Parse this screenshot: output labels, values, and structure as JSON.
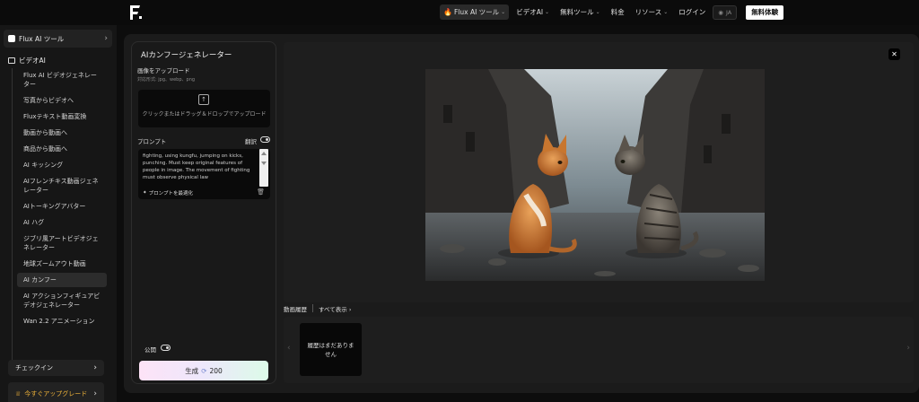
{
  "nav": {
    "items": [
      {
        "label": "Flux AI ツール",
        "active": true,
        "dropdown": true
      },
      {
        "label": "ビデオAI",
        "dropdown": true
      },
      {
        "label": "無料ツール",
        "dropdown": true
      },
      {
        "label": "料金",
        "dropdown": false
      },
      {
        "label": "リソース",
        "dropdown": true
      },
      {
        "label": "ログイン",
        "dropdown": false
      }
    ],
    "language": "JA",
    "trial_button": "無料体験"
  },
  "sidebar": {
    "tool_header": "Flux AI ツール",
    "video_section": "ビデオAI",
    "items": [
      "Flux AI ビデオジェネレーター",
      "写真からビデオへ",
      "Fluxテキスト動画変換",
      "動画から動画へ",
      "商品から動画へ",
      "AI キッシング",
      "AIフレンチキス動画ジェネレーター",
      "AIトーキングアバター",
      "AI ハグ",
      "ジブリ風アートビデオジェネレーター",
      "地球ズームアウト動画",
      "AI カンフー",
      "AI アクションフィギュアビデオジェネレーター",
      "Wan 2.2 アニメーション"
    ],
    "selected_index": 11,
    "checkin": "チェックイン",
    "upgrade": "今すぐアップグレード"
  },
  "panel": {
    "title": "AIカンフージェネレーター",
    "upload_label": "画像をアップロード",
    "upload_formats": "対応形式: jpg、webp、png",
    "upload_hint": "クリックまたはドラッグ＆ドロップでアップロード",
    "prompt_label": "プロンプト",
    "translate_label": "翻訳",
    "prompt_text": "fighting, using kungfu, jumping on kicks, punching. Must keep original features of people in image. The movement of fighting must observe physical law",
    "optimize_label": "プロンプトを最適化",
    "public_label": "公開",
    "generate_label": "生成",
    "generate_cost": "200"
  },
  "history": {
    "label": "動画履歴",
    "show_all": "すべて表示",
    "empty": "履歴はまだありません"
  },
  "colors": {
    "accent_gold": "#f0b43a",
    "bg": "#0d0d0d"
  }
}
